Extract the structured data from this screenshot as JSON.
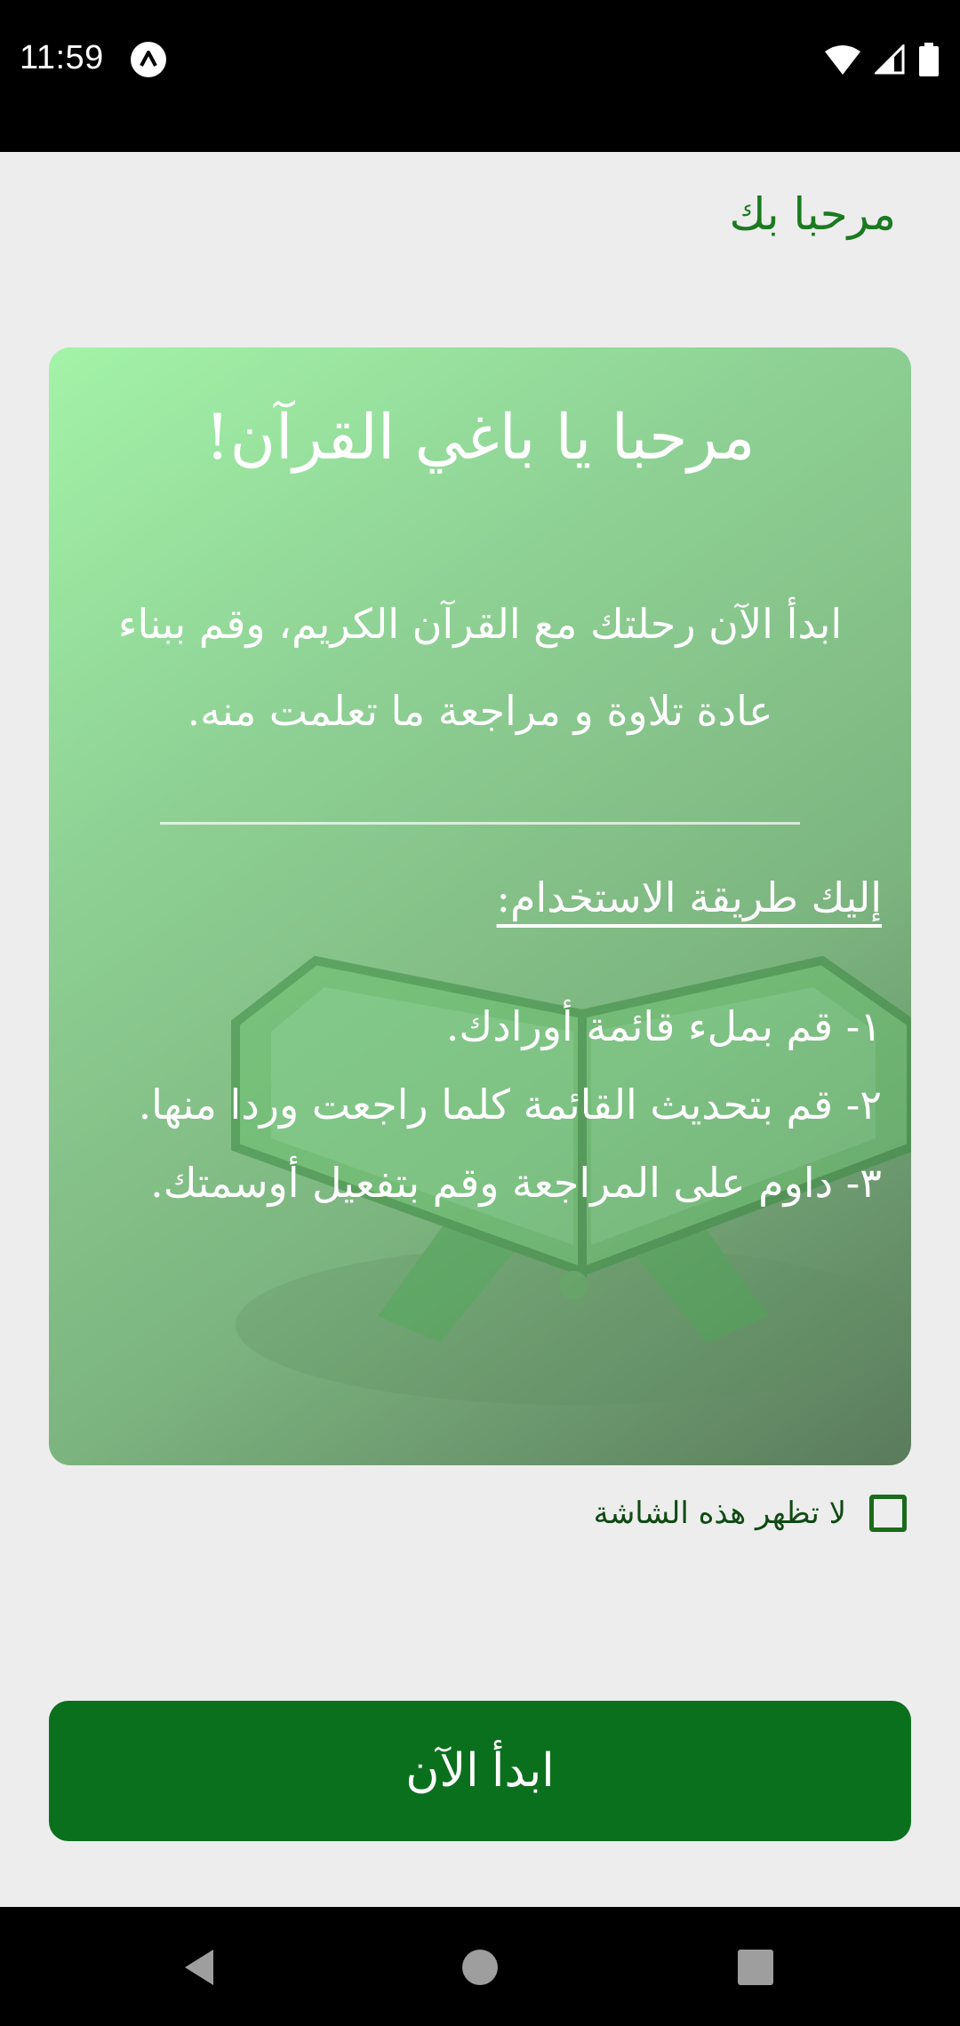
{
  "status_bar": {
    "time": "11:59",
    "icons": [
      "app-notification-icon",
      "wifi-icon",
      "signal-icon",
      "battery-icon"
    ]
  },
  "header": {
    "title": "مرحبا بك"
  },
  "card": {
    "heading": "مرحبا يا باغي القرآن!",
    "intro": "ابدأ الآن رحلتك مع القرآن الكريم، وقم ببناء عادة تلاوة و مراجعة ما تعلمت منه.",
    "howto_title": "إليك طريقة الاستخدام:",
    "steps": [
      "١- قم بملء قائمة أورادك.",
      "٢- قم بتحديث القائمة كلما راجعت وردا منها.",
      "٣- داوم على المراجعة وقم بتفعيل أوسمتك."
    ],
    "illustration": "quran-book-icon"
  },
  "dont_show": {
    "label": "لا تظهر هذه الشاشة",
    "checked": false
  },
  "start_button": {
    "label": "ابدأ الآن"
  },
  "nav_bar": {
    "buttons": [
      "back-icon",
      "home-icon",
      "recents-icon"
    ]
  },
  "colors": {
    "primary": "#0b701d",
    "title_green": "#1b7a1f",
    "card_start": "#a3f3a8",
    "card_end": "#5a7b5c"
  }
}
